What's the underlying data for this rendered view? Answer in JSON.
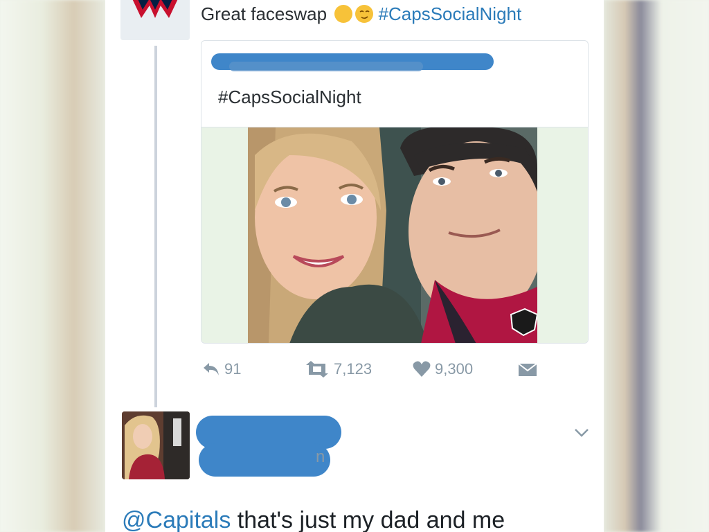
{
  "tweet": {
    "text": "Great faceswap",
    "emojis": [
      "ok-hand-emoji",
      "smirk-emoji"
    ],
    "hashtag": "#CapsSocialNight"
  },
  "quoted_tweet": {
    "text": "#CapsSocialNight"
  },
  "actions": {
    "replies": "91",
    "retweets": "7,123",
    "likes": "9,300"
  },
  "reply": {
    "handle_tail": "n",
    "mention": "@Capitals",
    "text": " that's just my dad and me"
  },
  "colors": {
    "link": "#2b7bb9",
    "redaction": "#3f86c9",
    "action_gray": "#8899a6"
  }
}
